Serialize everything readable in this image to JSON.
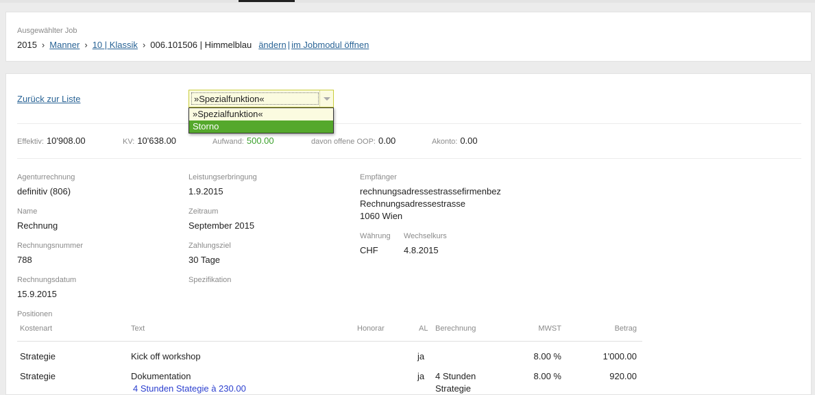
{
  "job": {
    "label": "Ausgewählter Job",
    "year": "2015",
    "client": "Manner",
    "project": "10 | Klassik",
    "job": "006.101506 | Himmelblau",
    "change_link": "ändern",
    "separator": "|",
    "open_link": "im Jobmodul öffnen"
  },
  "detail": {
    "back_link": "Zurück zur Liste",
    "select": {
      "value": "»Spezialfunktion«",
      "options": [
        "»Spezialfunktion«",
        "Storno"
      ],
      "highlighted": "Storno"
    },
    "totals": {
      "effektiv_label": "Effektiv:",
      "effektiv": "10'908.00",
      "kv_label": "KV:",
      "kv": "10'638.00",
      "aufwand_label": "Aufwand:",
      "aufwand": "500.00",
      "oop_label": "davon offene OOP:",
      "oop": "0.00",
      "akonto_label": "Akonto:",
      "akonto": "0.00"
    },
    "fields": {
      "agenturrechnung_label": "Agenturrechnung",
      "agenturrechnung": "definitiv (806)",
      "name_label": "Name",
      "name": "Rechnung",
      "rechnungsnummer_label": "Rechnungsnummer",
      "rechnungsnummer": "788",
      "rechnungsdatum_label": "Rechnungsdatum",
      "rechnungsdatum": "15.9.2015",
      "leistung_label": "Leistungserbringung",
      "leistung": "1.9.2015",
      "zeitraum_label": "Zeitraum",
      "zeitraum": "September 2015",
      "zahlungsziel_label": "Zahlungsziel",
      "zahlungsziel": "30 Tage",
      "spezifikation_label": "Spezifikation",
      "empfaenger_label": "Empfänger",
      "empfaenger_line1": "rechnungsadressestrassefirmenbez",
      "empfaenger_line2": "Rechnungsadressestrasse",
      "empfaenger_line3": "1060 Wien",
      "waehrung_label": "Währung",
      "waehrung": "CHF",
      "wechselkurs_label": "Wechselkurs",
      "wechselkurs": "4.8.2015"
    },
    "positions": {
      "title": "Positionen",
      "columns": [
        "Kostenart",
        "Text",
        "Honorar",
        "AL",
        "Berechnung",
        "MWST",
        "Betrag"
      ],
      "rows": [
        {
          "kostenart": "Strategie",
          "text": "Kick off workshop",
          "sub": "",
          "honorar": "",
          "al": "ja",
          "berechnung_1": "",
          "berechnung_2": "",
          "mwst": "8.00 %",
          "betrag": "1'000.00"
        },
        {
          "kostenart": "Strategie",
          "text": "Dokumentation",
          "sub": "4 Stunden Stategie à 230.00",
          "honorar": "",
          "al": "ja",
          "berechnung_1": "4 Stunden",
          "berechnung_2": "Strategie",
          "mwst": "8.00 %",
          "betrag": "920.00"
        }
      ]
    }
  },
  "colors": {
    "accent_link": "#2a6496",
    "highlight": "#55a82c",
    "select_bg": "#fbfbe0",
    "value_green": "#3aa02a"
  }
}
